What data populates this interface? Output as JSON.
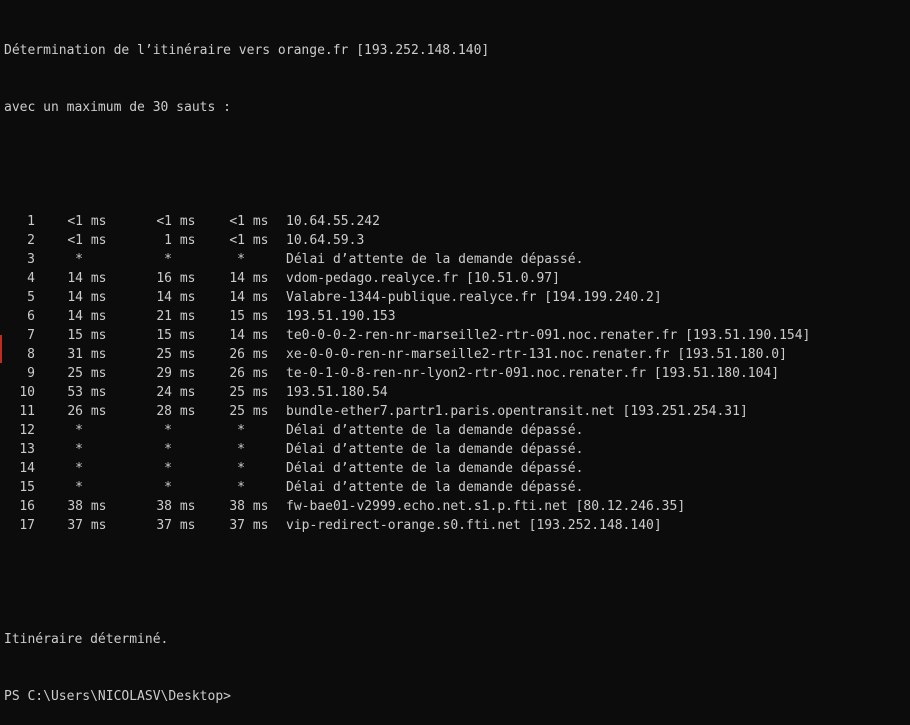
{
  "header": {
    "line1": "Détermination de l’itinéraire vers orange.fr [193.252.148.140]",
    "line2": "avec un maximum de 30 sauts :"
  },
  "hops": [
    {
      "num": "1",
      "r1": "<1",
      "u1": "ms",
      "r2": "<1",
      "u2": "ms",
      "r3": "<1",
      "u3": "ms",
      "host": "10.64.55.242"
    },
    {
      "num": "2",
      "r1": "<1",
      "u1": "ms",
      "r2": "1",
      "u2": "ms",
      "r3": "<1",
      "u3": "ms",
      "host": "10.64.59.3"
    },
    {
      "num": "3",
      "r1": "*",
      "u1": "",
      "r2": "*",
      "u2": "",
      "r3": "*",
      "u3": "",
      "host": "Délai d’attente de la demande dépassé."
    },
    {
      "num": "4",
      "r1": "14",
      "u1": "ms",
      "r2": "16",
      "u2": "ms",
      "r3": "14",
      "u3": "ms",
      "host": "vdom-pedago.realyce.fr [10.51.0.97]"
    },
    {
      "num": "5",
      "r1": "14",
      "u1": "ms",
      "r2": "14",
      "u2": "ms",
      "r3": "14",
      "u3": "ms",
      "host": "Valabre-1344-publique.realyce.fr [194.199.240.2]"
    },
    {
      "num": "6",
      "r1": "14",
      "u1": "ms",
      "r2": "21",
      "u2": "ms",
      "r3": "15",
      "u3": "ms",
      "host": "193.51.190.153"
    },
    {
      "num": "7",
      "r1": "15",
      "u1": "ms",
      "r2": "15",
      "u2": "ms",
      "r3": "14",
      "u3": "ms",
      "host": "te0-0-0-2-ren-nr-marseille2-rtr-091.noc.renater.fr [193.51.190.154]"
    },
    {
      "num": "8",
      "r1": "31",
      "u1": "ms",
      "r2": "25",
      "u2": "ms",
      "r3": "26",
      "u3": "ms",
      "host": "xe-0-0-0-ren-nr-marseille2-rtr-131.noc.renater.fr [193.51.180.0]"
    },
    {
      "num": "9",
      "r1": "25",
      "u1": "ms",
      "r2": "29",
      "u2": "ms",
      "r3": "26",
      "u3": "ms",
      "host": "te-0-1-0-8-ren-nr-lyon2-rtr-091.noc.renater.fr [193.51.180.104]"
    },
    {
      "num": "10",
      "r1": "53",
      "u1": "ms",
      "r2": "24",
      "u2": "ms",
      "r3": "25",
      "u3": "ms",
      "host": "193.51.180.54"
    },
    {
      "num": "11",
      "r1": "26",
      "u1": "ms",
      "r2": "28",
      "u2": "ms",
      "r3": "25",
      "u3": "ms",
      "host": "bundle-ether7.partr1.paris.opentransit.net [193.251.254.31]"
    },
    {
      "num": "12",
      "r1": "*",
      "u1": "",
      "r2": "*",
      "u2": "",
      "r3": "*",
      "u3": "",
      "host": "Délai d’attente de la demande dépassé."
    },
    {
      "num": "13",
      "r1": "*",
      "u1": "",
      "r2": "*",
      "u2": "",
      "r3": "*",
      "u3": "",
      "host": "Délai d’attente de la demande dépassé."
    },
    {
      "num": "14",
      "r1": "*",
      "u1": "",
      "r2": "*",
      "u2": "",
      "r3": "*",
      "u3": "",
      "host": "Délai d’attente de la demande dépassé."
    },
    {
      "num": "15",
      "r1": "*",
      "u1": "",
      "r2": "*",
      "u2": "",
      "r3": "*",
      "u3": "",
      "host": "Délai d’attente de la demande dépassé."
    },
    {
      "num": "16",
      "r1": "38",
      "u1": "ms",
      "r2": "38",
      "u2": "ms",
      "r3": "38",
      "u3": "ms",
      "host": "fw-bae01-v2999.echo.net.s1.p.fti.net [80.12.246.35]"
    },
    {
      "num": "17",
      "r1": "37",
      "u1": "ms",
      "r2": "37",
      "u2": "ms",
      "r3": "37",
      "u3": "ms",
      "host": "vip-redirect-orange.s0.fti.net [193.252.148.140]"
    }
  ],
  "footer": {
    "done": "Itinéraire déterminé.",
    "prompt": "PS C:\\Users\\NICOLASV\\Desktop>"
  },
  "colors": {
    "background": "#0c0c0c",
    "foreground": "#cccccc"
  }
}
